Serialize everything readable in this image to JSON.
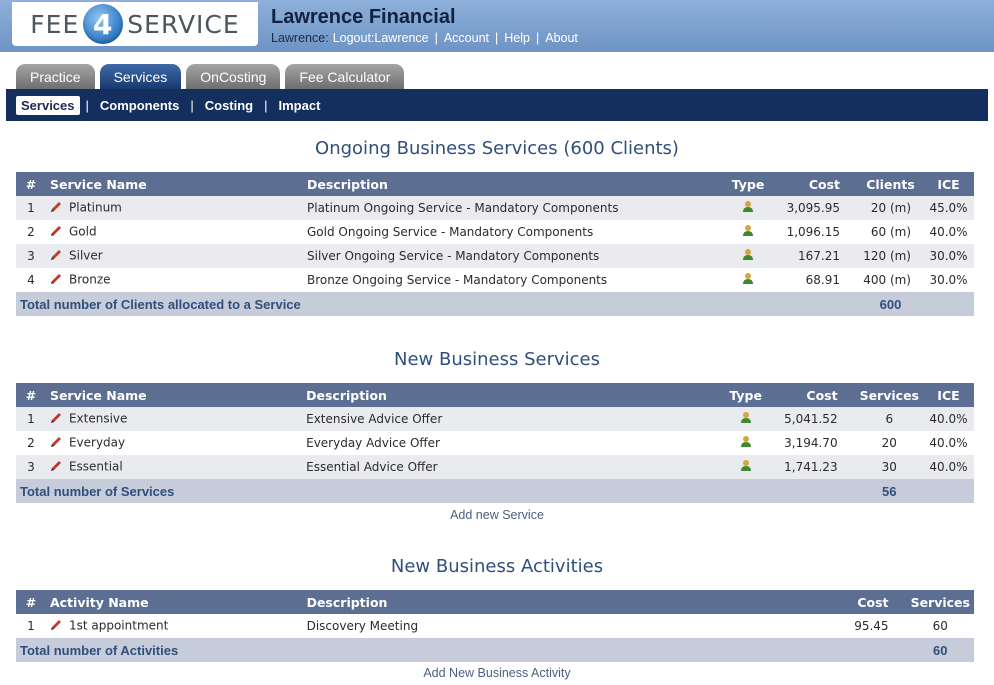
{
  "logo": {
    "left": "FEE",
    "digit": "4",
    "right": "SERVICE"
  },
  "header": {
    "firm_name": "Lawrence Financial",
    "user_label": "Lawrence:",
    "links": [
      "Logout:Lawrence",
      "Account",
      "Help",
      "About"
    ]
  },
  "tabs": [
    {
      "label": "Practice",
      "active": false
    },
    {
      "label": "Services",
      "active": true
    },
    {
      "label": "OnCosting",
      "active": false
    },
    {
      "label": "Fee Calculator",
      "active": false
    }
  ],
  "subnav": [
    {
      "label": "Services",
      "active": true
    },
    {
      "label": "Components",
      "active": false
    },
    {
      "label": "Costing",
      "active": false
    },
    {
      "label": "Impact",
      "active": false
    }
  ],
  "ongoing": {
    "title": "Ongoing Business Services (600 Clients)",
    "headers": [
      "#",
      "Service Name",
      "Description",
      "Type",
      "Cost",
      "Clients",
      "ICE"
    ],
    "rows": [
      {
        "num": "1",
        "name": "Platinum",
        "description": "Platinum Ongoing Service - Mandatory Components",
        "cost": "3,095.95",
        "clients": "20 (m)",
        "ice": "45.0%"
      },
      {
        "num": "2",
        "name": "Gold",
        "description": "Gold Ongoing Service - Mandatory Components",
        "cost": "1,096.15",
        "clients": "60 (m)",
        "ice": "40.0%"
      },
      {
        "num": "3",
        "name": "Silver",
        "description": "Silver Ongoing Service - Mandatory Components",
        "cost": "167.21",
        "clients": "120 (m)",
        "ice": "30.0%"
      },
      {
        "num": "4",
        "name": "Bronze",
        "description": "Bronze Ongoing Service - Mandatory Components",
        "cost": "68.91",
        "clients": "400 (m)",
        "ice": "30.0%"
      }
    ],
    "total_label": "Total number of Clients allocated to a Service",
    "total_value": "600"
  },
  "new_services": {
    "title": "New Business Services",
    "headers": [
      "#",
      "Service Name",
      "Description",
      "Type",
      "Cost",
      "Services",
      "ICE"
    ],
    "rows": [
      {
        "num": "1",
        "name": "Extensive",
        "description": "Extensive Advice Offer",
        "cost": "5,041.52",
        "services": "6",
        "ice": "40.0%"
      },
      {
        "num": "2",
        "name": "Everyday",
        "description": "Everyday Advice Offer",
        "cost": "3,194.70",
        "services": "20",
        "ice": "40.0%"
      },
      {
        "num": "3",
        "name": "Essential",
        "description": "Essential Advice Offer",
        "cost": "1,741.23",
        "services": "30",
        "ice": "40.0%"
      }
    ],
    "total_label": "Total number of Services",
    "total_value": "56",
    "add_link": "Add new Service"
  },
  "activities": {
    "title": "New Business Activities",
    "headers": [
      "#",
      "Activity Name",
      "Description",
      "Cost",
      "Services"
    ],
    "rows": [
      {
        "num": "1",
        "name": "1st appointment",
        "description": "Discovery Meeting",
        "cost": "95.45",
        "services": "60"
      }
    ],
    "total_label": "Total number of Activities",
    "total_value": "60",
    "add_link": "Add New Business Activity"
  },
  "icons": {
    "edit": "pencil-icon",
    "type": "person-icon"
  },
  "colors": {
    "header_bg": "#7ea2d0",
    "nav_bg": "#142f5e",
    "table_header": "#5c6f93",
    "title": "#2f4f7c"
  }
}
